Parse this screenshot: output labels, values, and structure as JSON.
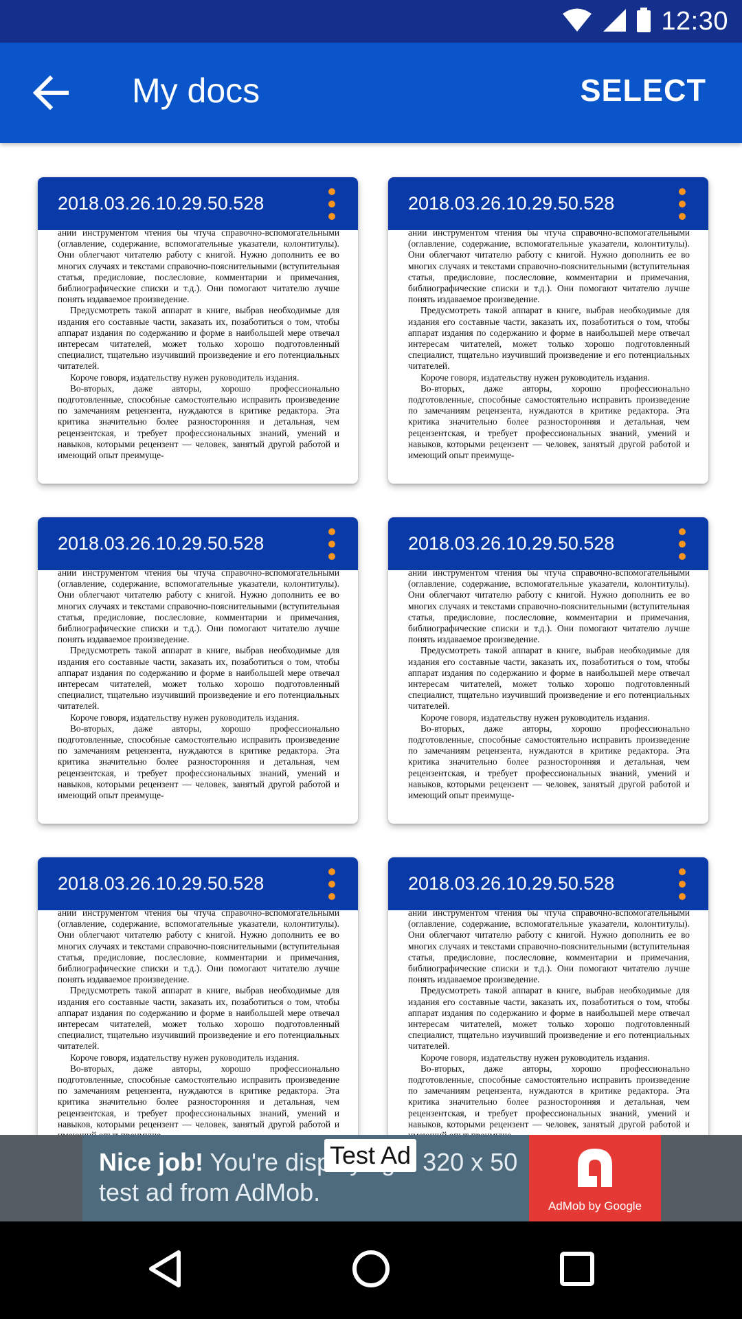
{
  "status_bar": {
    "time": "12:30"
  },
  "app_bar": {
    "title": "My docs",
    "select_label": "SELECT"
  },
  "docs": [
    {
      "title": "2018.03.26.10.29.50.528"
    },
    {
      "title": "2018.03.26.10.29.50.528"
    },
    {
      "title": "2018.03.26.10.29.50.528"
    },
    {
      "title": "2018.03.26.10.29.50.528"
    },
    {
      "title": "2018.03.26.10.29.50.528"
    },
    {
      "title": "2018.03.26.10.29.50.528"
    }
  ],
  "doc_preview": {
    "paragraphs": [
      "ании инструментом чтения бы чтуча справочно-вспомогательными (оглавление, содержание, вспомогательные указатели, колонтитулы). Они облегчают читателю работу с книгой. Нужно дополнить ее во многих случаях и текстами справочно-пояснительными (вступительная статья, предисловие, послесловие, комментарии и примечания, библиографические списки и т.д.). Они помогают читателю лучше понять издаваемое произведение.",
      "Предусмотреть такой аппарат в книге, выбрав необходимые для издания его составные части, заказать их, позаботиться о том, чтобы аппарат издания по содержанию и форме в наибольшей мере отвечал интересам читателей, может только хорошо подготовленный специалист, тщательно изучивший произведение и его потенциальных читателей.",
      "Короче говоря, издательству нужен руководитель издания.",
      "Во-вторых, даже авторы, хорошо профессионально подготовленные, способные самостоятельно исправить произведение по замечаниям рецензента, нуждаются в критике редактора. Эта критика значительно более разносторонняя и детальная, чем рецензентская, и требует профессиональных знаний, умений и навыков, которыми рецензент — человек, занятый другой работой и имеющий опыт преимуще-"
    ]
  },
  "ad": {
    "headline": "Nice job!",
    "body": " You're displaying a 320 x 50 test ad from AdMob.",
    "label": "Test Ad",
    "logo_text": "AdMob by Google"
  },
  "colors": {
    "status_bar": "#142f8c",
    "app_bar": "#0a55c9",
    "card_header": "#0a3aa8",
    "overflow_dots": "#f7941d",
    "ad_logo": "#e53935"
  },
  "icons": {
    "back": "arrow-back-icon",
    "more": "more-vertical-icon",
    "wifi": "wifi-icon",
    "signal": "signal-icon",
    "battery": "battery-icon",
    "nav_back": "triangle-back-icon",
    "nav_home": "circle-home-icon",
    "nav_recents": "square-recents-icon"
  }
}
